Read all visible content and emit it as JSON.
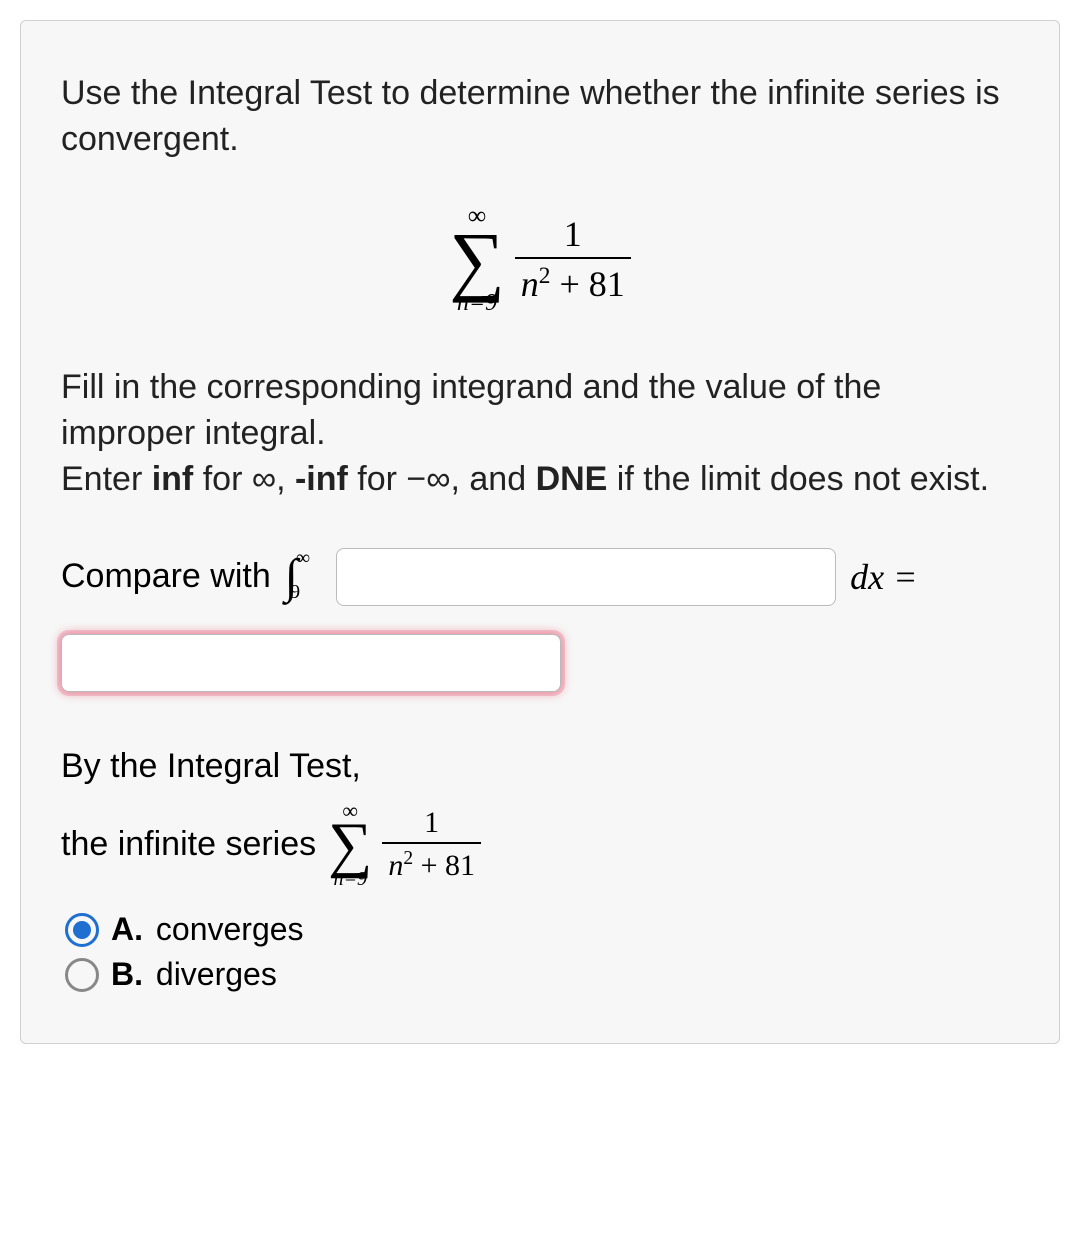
{
  "prompt": "Use the Integral Test to determine whether the infinite series is convergent.",
  "series": {
    "upper": "∞",
    "lower": "n=9",
    "frac_num": "1",
    "frac_den_html": "n² + 81"
  },
  "instructions": {
    "line1": "Fill in the corresponding integrand and the value of the improper integral.",
    "line2_pre": "Enter ",
    "inf_bold": "inf",
    "for_inf": " for ∞, ",
    "neg_inf_bold": "-inf",
    "for_neg_inf": " for −∞, and ",
    "dne_bold": "DNE",
    "tail": " if the limit does not exist."
  },
  "compare": {
    "label": "Compare with",
    "integral_lower": "9",
    "integral_upper": "∞",
    "integrand_value": "",
    "dx_label": "dx =",
    "result_value": ""
  },
  "conclusion": {
    "line1": "By the Integral Test,",
    "line2_pre": "the infinite series",
    "series_upper": "∞",
    "series_lower": "n=9",
    "frac_num": "1",
    "frac_den_html": "n² + 81"
  },
  "options": {
    "a_letter": "A.",
    "a_text": "converges",
    "b_letter": "B.",
    "b_text": "diverges",
    "selected": "A"
  }
}
